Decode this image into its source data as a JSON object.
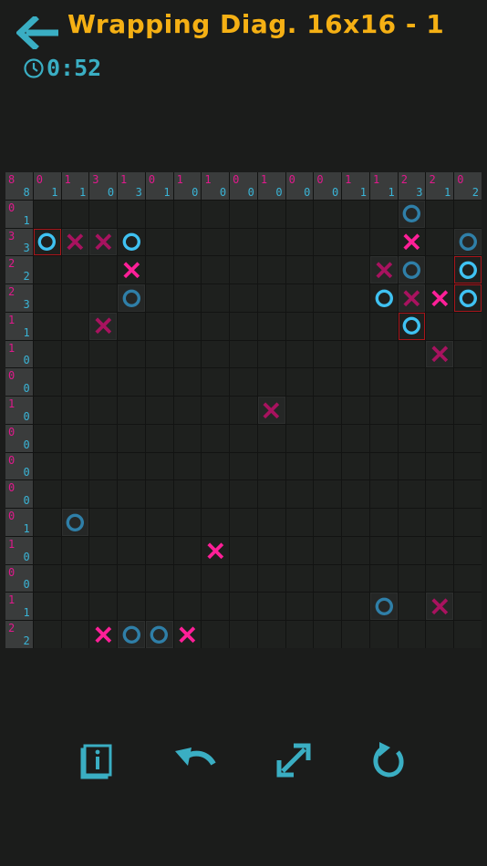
{
  "header": {
    "title": "Wrapping Diag. 16x16 - 1",
    "timer": "0:52",
    "back_icon": "arrow-left-icon",
    "accent": "#f5b014",
    "cyan": "#3aaec3"
  },
  "colors": {
    "x_mark": "#ff1f98",
    "x_dim": "#a8125f",
    "o_mark": "#3fc2f2",
    "o_dim": "#2f7fa8"
  },
  "column_clues": [
    {
      "top": "0",
      "bottom": "1"
    },
    {
      "top": "1",
      "bottom": "1"
    },
    {
      "top": "3",
      "bottom": "0"
    },
    {
      "top": "1",
      "bottom": "3"
    },
    {
      "top": "0",
      "bottom": "1"
    },
    {
      "top": "1",
      "bottom": "0"
    },
    {
      "top": "1",
      "bottom": "0"
    },
    {
      "top": "0",
      "bottom": "0"
    },
    {
      "top": "1",
      "bottom": "0"
    },
    {
      "top": "0",
      "bottom": "0"
    },
    {
      "top": "0",
      "bottom": "0"
    },
    {
      "top": "1",
      "bottom": "1"
    },
    {
      "top": "1",
      "bottom": "1"
    },
    {
      "top": "2",
      "bottom": "3"
    },
    {
      "top": "2",
      "bottom": "1"
    },
    {
      "top": "0",
      "bottom": "2"
    }
  ],
  "corner_clue": {
    "top": "8",
    "bottom": "8"
  },
  "row_clues": [
    {
      "top": "0",
      "bottom": "1"
    },
    {
      "top": "3",
      "bottom": "3"
    },
    {
      "top": "2",
      "bottom": "2"
    },
    {
      "top": "2",
      "bottom": "3"
    },
    {
      "top": "1",
      "bottom": "1"
    },
    {
      "top": "1",
      "bottom": "0"
    },
    {
      "top": "0",
      "bottom": "0"
    },
    {
      "top": "1",
      "bottom": "0"
    },
    {
      "top": "0",
      "bottom": "0"
    },
    {
      "top": "0",
      "bottom": "0"
    },
    {
      "top": "0",
      "bottom": "0"
    },
    {
      "top": "0",
      "bottom": "1"
    },
    {
      "top": "1",
      "bottom": "0"
    },
    {
      "top": "0",
      "bottom": "0"
    },
    {
      "top": "1",
      "bottom": "1"
    },
    {
      "top": "2",
      "bottom": "2"
    }
  ],
  "marks": [
    {
      "r": 0,
      "c": 13,
      "t": "O",
      "s": "dim"
    },
    {
      "r": 1,
      "c": 0,
      "t": "O",
      "s": "bright",
      "hl": true
    },
    {
      "r": 1,
      "c": 1,
      "t": "X",
      "s": "dim"
    },
    {
      "r": 1,
      "c": 2,
      "t": "X",
      "s": "dim"
    },
    {
      "r": 1,
      "c": 3,
      "t": "O",
      "s": "bright"
    },
    {
      "r": 1,
      "c": 13,
      "t": "X",
      "s": "bright"
    },
    {
      "r": 1,
      "c": 15,
      "t": "O",
      "s": "dim"
    },
    {
      "r": 2,
      "c": 3,
      "t": "X",
      "s": "bright"
    },
    {
      "r": 2,
      "c": 12,
      "t": "X",
      "s": "dim"
    },
    {
      "r": 2,
      "c": 13,
      "t": "O",
      "s": "dim"
    },
    {
      "r": 2,
      "c": 15,
      "t": "O",
      "s": "bright",
      "hl": true
    },
    {
      "r": 3,
      "c": 3,
      "t": "O",
      "s": "dim"
    },
    {
      "r": 3,
      "c": 12,
      "t": "O",
      "s": "bright"
    },
    {
      "r": 3,
      "c": 13,
      "t": "X",
      "s": "dim"
    },
    {
      "r": 3,
      "c": 14,
      "t": "X",
      "s": "bright"
    },
    {
      "r": 3,
      "c": 15,
      "t": "O",
      "s": "bright",
      "hl": true
    },
    {
      "r": 4,
      "c": 2,
      "t": "X",
      "s": "dim"
    },
    {
      "r": 4,
      "c": 13,
      "t": "O",
      "s": "bright",
      "hl": true
    },
    {
      "r": 5,
      "c": 14,
      "t": "X",
      "s": "dim"
    },
    {
      "r": 7,
      "c": 8,
      "t": "X",
      "s": "dim"
    },
    {
      "r": 11,
      "c": 1,
      "t": "O",
      "s": "dim"
    },
    {
      "r": 12,
      "c": 6,
      "t": "X",
      "s": "bright"
    },
    {
      "r": 14,
      "c": 12,
      "t": "O",
      "s": "dim"
    },
    {
      "r": 14,
      "c": 14,
      "t": "X",
      "s": "dim"
    },
    {
      "r": 15,
      "c": 2,
      "t": "X",
      "s": "bright"
    },
    {
      "r": 15,
      "c": 3,
      "t": "O",
      "s": "dim"
    },
    {
      "r": 15,
      "c": 4,
      "t": "O",
      "s": "dim"
    },
    {
      "r": 15,
      "c": 5,
      "t": "X",
      "s": "bright"
    }
  ],
  "toolbar": {
    "info_icon": "info-book-icon",
    "undo_icon": "undo-icon",
    "resize_icon": "resize-diagonal-icon",
    "restart_icon": "restart-icon"
  }
}
